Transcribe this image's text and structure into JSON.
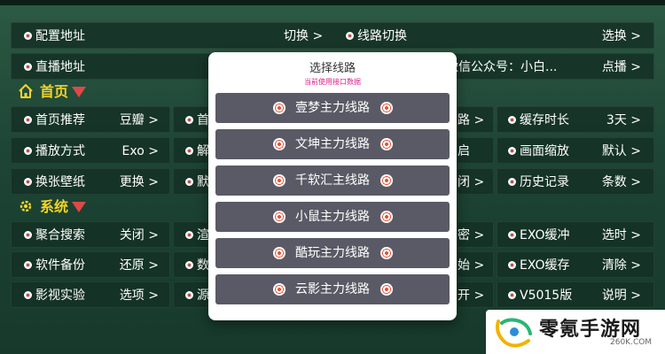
{
  "top_rows": [
    {
      "label": "配置地址",
      "mid": "切换 >",
      "right_label": "线路切换",
      "value": "选换 >"
    },
    {
      "label": "直播地址",
      "mid_text": "微信公众号：小白...",
      "value": "点播 >"
    }
  ],
  "sections": {
    "home": "首页",
    "system": "系统"
  },
  "grid": {
    "col1": [
      {
        "label": "首页推荐",
        "value": "豆瓣 >"
      },
      {
        "label": "播放方式",
        "value": "Exo >"
      },
      {
        "label": "换张壁纸",
        "value": "更换 >"
      },
      {
        "label": "聚合搜索",
        "value": "关闭 >"
      },
      {
        "label": "软件备份",
        "value": "还原 >"
      },
      {
        "label": "影视实验",
        "value": "选项 >"
      }
    ],
    "col2": [
      {
        "label": "首"
      },
      {
        "label": "解"
      },
      {
        "label": "默"
      },
      {
        "label": "渲"
      },
      {
        "label": "数"
      },
      {
        "label": "源"
      }
    ],
    "col3": [
      {
        "value": "路 >"
      },
      {
        "value": "启"
      },
      {
        "value": "闭 >"
      },
      {
        "value": "密 >"
      },
      {
        "value": "始 >"
      },
      {
        "value": "开 >"
      }
    ],
    "col4": [
      {
        "label": "缓存时长",
        "value": "3天 >"
      },
      {
        "label": "画面缩放",
        "value": "默认 >"
      },
      {
        "label": "历史记录",
        "value": "条数 >"
      },
      {
        "label": "EXO缓冲",
        "value": "选时 >"
      },
      {
        "label": "EXO缓存",
        "value": "清除 >"
      },
      {
        "label": "V5015版",
        "value": "说明 >"
      }
    ]
  },
  "modal": {
    "title": "选择线路",
    "subtitle": "当前使用接口数据",
    "routes": [
      "壹梦主力线路",
      "文坤主力线路",
      "千软汇主线路",
      "小鼠主力线路",
      "酷玩主力线路",
      "云影主力线路"
    ]
  },
  "watermark": {
    "text": "零氪手游网",
    "sub": "260K.COM"
  },
  "colors": {
    "section_accent": "#f2d32a",
    "triangle": "#e04848",
    "modal_subtitle": "#e0208a",
    "route_button": "#5a5a66"
  }
}
